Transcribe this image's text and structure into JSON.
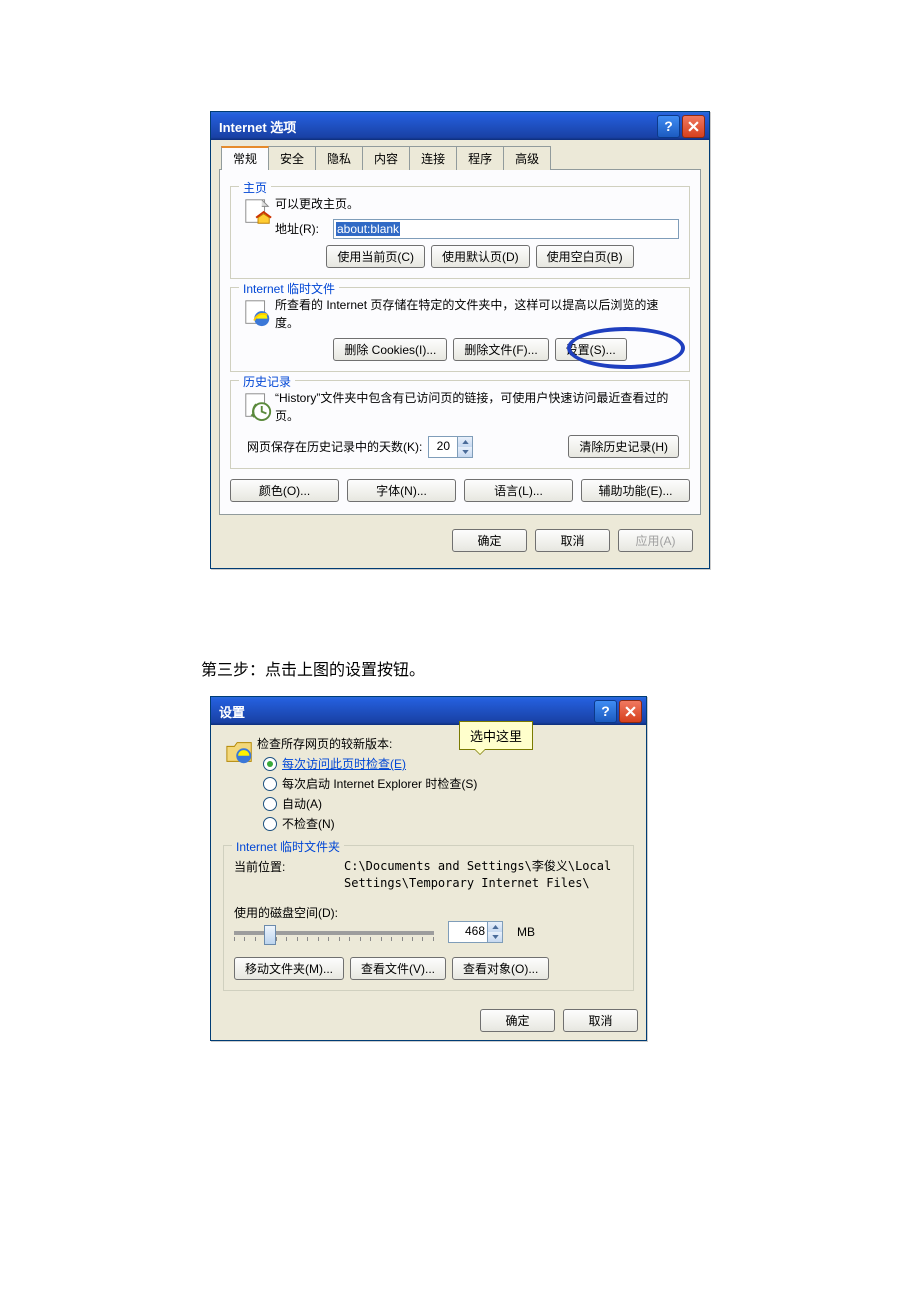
{
  "dialog1": {
    "title": "Internet 选项",
    "tabs": [
      "常规",
      "安全",
      "隐私",
      "内容",
      "连接",
      "程序",
      "高级"
    ],
    "home": {
      "legend": "主页",
      "desc": "可以更改主页。",
      "addr_label": "地址(R):",
      "addr_value": "about:blank",
      "btn_current": "使用当前页(C)",
      "btn_default": "使用默认页(D)",
      "btn_blank": "使用空白页(B)"
    },
    "temp": {
      "legend": "Internet 临时文件",
      "desc": "所查看的 Internet 页存储在特定的文件夹中，这样可以提高以后浏览的速度。",
      "btn_cookies": "删除 Cookies(I)...",
      "btn_files": "删除文件(F)...",
      "btn_settings": "设置(S)..."
    },
    "history": {
      "legend": "历史记录",
      "desc": "“History”文件夹中包含有已访问页的链接，可使用户快速访问最近查看过的页。",
      "days_label": "网页保存在历史记录中的天数(K):",
      "days_value": "20",
      "btn_clear": "清除历史记录(H)"
    },
    "bottom": {
      "colors": "颜色(O)...",
      "fonts": "字体(N)...",
      "languages": "语言(L)...",
      "accessibility": "辅助功能(E)..."
    },
    "dlg_ok": "确定",
    "dlg_cancel": "取消",
    "dlg_apply": "应用(A)"
  },
  "step_text": "第三步：点击上图的设置按钮。",
  "dialog2": {
    "title": "设置",
    "callout": "选中这里",
    "check_label": "检查所存网页的较新版本:",
    "radios": {
      "r1": "每次访问此页时检查(E)",
      "r2": "每次启动 Internet Explorer 时检查(S)",
      "r3": "自动(A)",
      "r4": "不检查(N)"
    },
    "tempfolder": {
      "legend": "Internet 临时文件夹",
      "loc_label": "当前位置:",
      "loc_value": "C:\\Documents and Settings\\李俊义\\Local Settings\\Temporary Internet Files\\",
      "disk_label": "使用的磁盘空间(D):",
      "disk_value": "468",
      "disk_unit": "MB",
      "btn_move": "移动文件夹(M)...",
      "btn_view": "查看文件(V)...",
      "btn_obj": "查看对象(O)..."
    },
    "dlg_ok": "确定",
    "dlg_cancel": "取消"
  }
}
